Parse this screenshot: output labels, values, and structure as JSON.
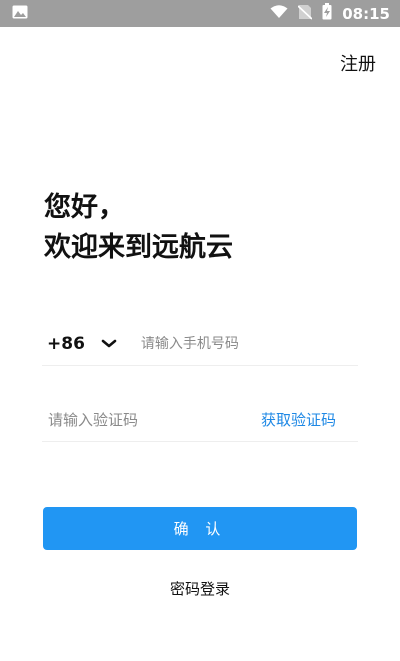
{
  "status_bar": {
    "time": "08:15",
    "icons": [
      "image-icon",
      "wifi-icon",
      "no-sim-icon",
      "battery-charging-icon"
    ]
  },
  "header": {
    "register_label": "注册"
  },
  "greeting": {
    "line1": "您好，",
    "line2": "欢迎来到远航云"
  },
  "phone": {
    "country_code": "+86",
    "placeholder": "请输入手机号码"
  },
  "verification": {
    "placeholder": "请输入验证码",
    "get_code_label": "获取验证码"
  },
  "actions": {
    "confirm_label": "确 认",
    "password_login_label": "密码登录"
  },
  "colors": {
    "accent": "#2196f3",
    "link": "#1e88e5",
    "status_bar": "#9e9e9e"
  }
}
